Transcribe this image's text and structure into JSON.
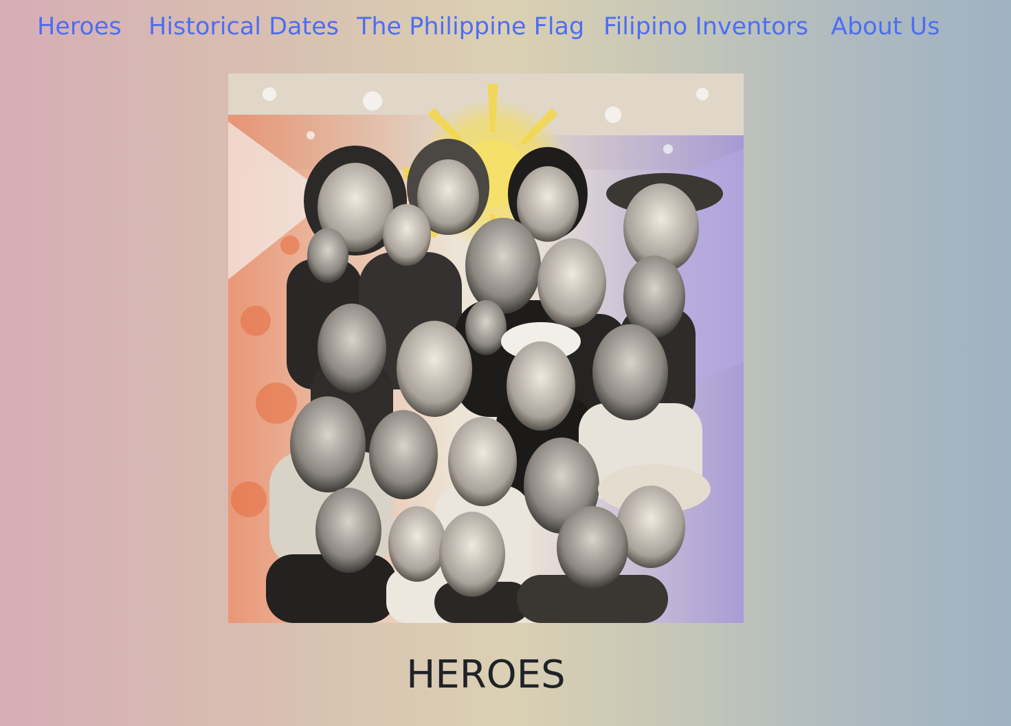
{
  "nav": {
    "items": [
      {
        "label": "Heroes"
      },
      {
        "label": "Historical Dates"
      },
      {
        "label": "The Philippine Flag"
      },
      {
        "label": "Filipino Inventors"
      },
      {
        "label": "About Us"
      }
    ],
    "link_color": "#4d6ef2"
  },
  "hero_image": {
    "alt": "Collage of Filipino heroes"
  },
  "page": {
    "title": "HEROES",
    "title_color": "#1f2328"
  }
}
